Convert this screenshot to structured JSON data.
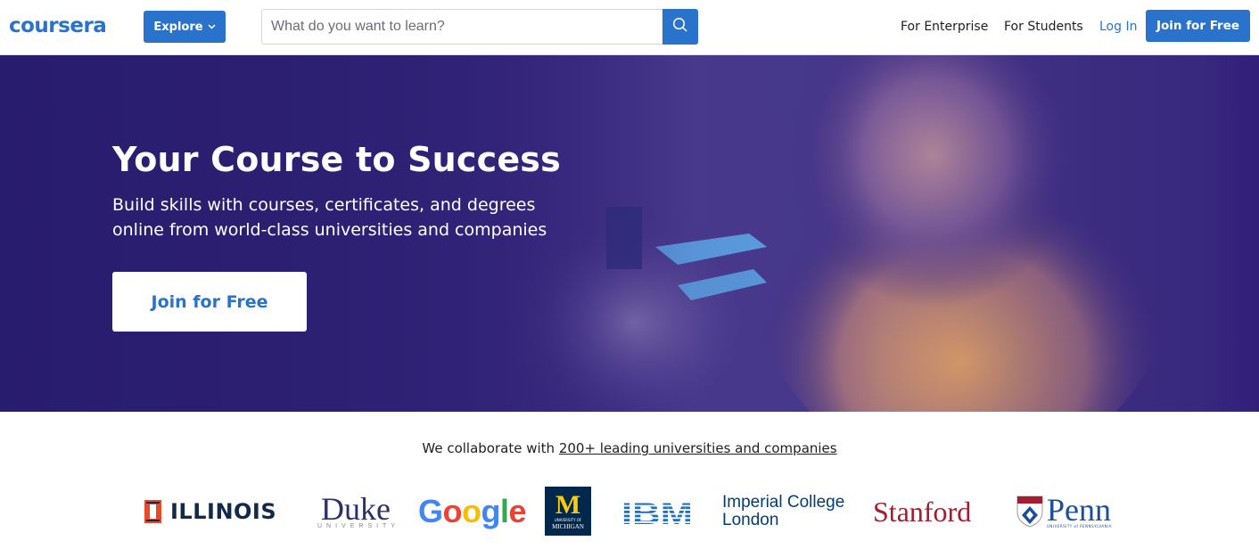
{
  "header": {
    "logo_text": "coursera",
    "explore_label": "Explore",
    "search": {
      "placeholder": "What do you want to learn?",
      "value": ""
    },
    "nav": {
      "for_enterprise": "For Enterprise",
      "for_students": "For Students",
      "log_in": "Log In",
      "join_for_free": "Join for Free"
    }
  },
  "hero": {
    "title": "Your Course to Success",
    "subtitle": "Build skills with courses, certificates, and degrees online from world-class universities and companies",
    "cta_label": "Join for Free"
  },
  "partners": {
    "intro_text": "We collaborate with ",
    "intro_link": "200+ leading universities and companies",
    "logos": {
      "illinois": "ILLINOIS",
      "duke": "Duke",
      "duke_sub": "UNIVERSITY",
      "google": [
        "G",
        "o",
        "o",
        "g",
        "l",
        "e"
      ],
      "michigan": "M",
      "michigan_sub1": "UNIVERSITY OF",
      "michigan_sub2": "MICHIGAN",
      "ibm": "IBM",
      "imperial_line1": "Imperial College",
      "imperial_line2": "London",
      "stanford": "Stanford",
      "penn": "Penn",
      "penn_sub": "UNIVERSITY of PENNSYLVANIA"
    }
  },
  "colors": {
    "brand_blue": "#2a73cc",
    "hero_purple": "#33247a",
    "illinois_orange": "#e84a27",
    "illinois_navy": "#13294b",
    "stanford_red": "#a51c30",
    "michigan_maize": "#ffcb05",
    "michigan_blue": "#00274c",
    "google_blue": "#4285f4",
    "google_red": "#ea4335",
    "google_yellow": "#fbbc05",
    "google_green": "#34a853"
  },
  "icons": {
    "search": "search-icon",
    "explore_chevron": "chevron-down-icon"
  }
}
